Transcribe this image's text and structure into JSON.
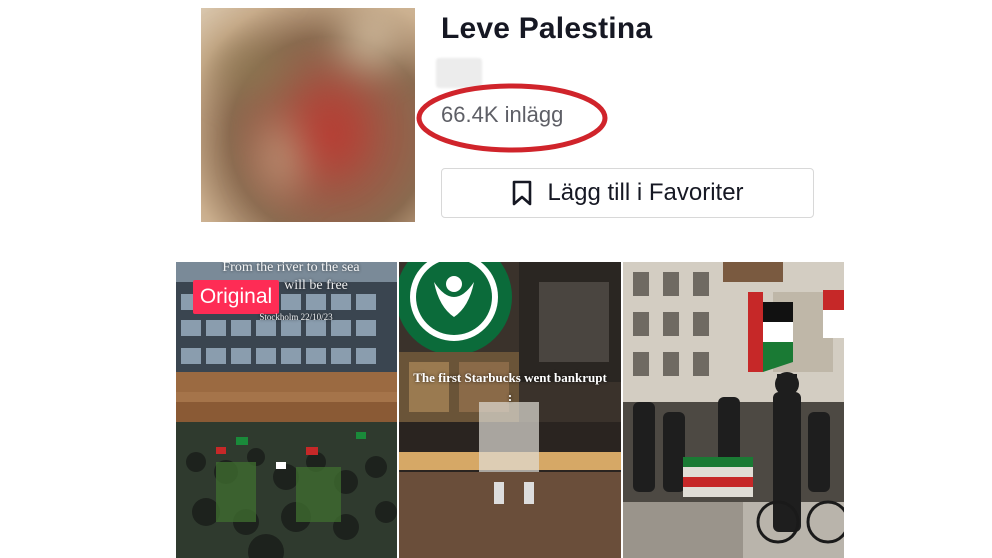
{
  "hashtag": {
    "title": "Leve Palestina",
    "post_count": "66.4K inlägg",
    "favorite_button_label": "Lägg till i Favoriter",
    "favorite_icon": "bookmark-icon"
  },
  "annotation": {
    "highlight_color": "#d0242b",
    "shape": "ellipse around post count"
  },
  "videos": [
    {
      "badge": "Original",
      "overlay_line1": "From the river to the sea",
      "overlay_line2": "will be free",
      "overlay_caption": "Stockholm 22/10/23"
    },
    {
      "overlay_caption": "The first Starbucks went bankrupt :"
    },
    {
      "overlay_caption": ""
    }
  ],
  "colors": {
    "badge": "#fe2c55",
    "text_primary": "#161823",
    "text_secondary": "#5e5f66"
  }
}
